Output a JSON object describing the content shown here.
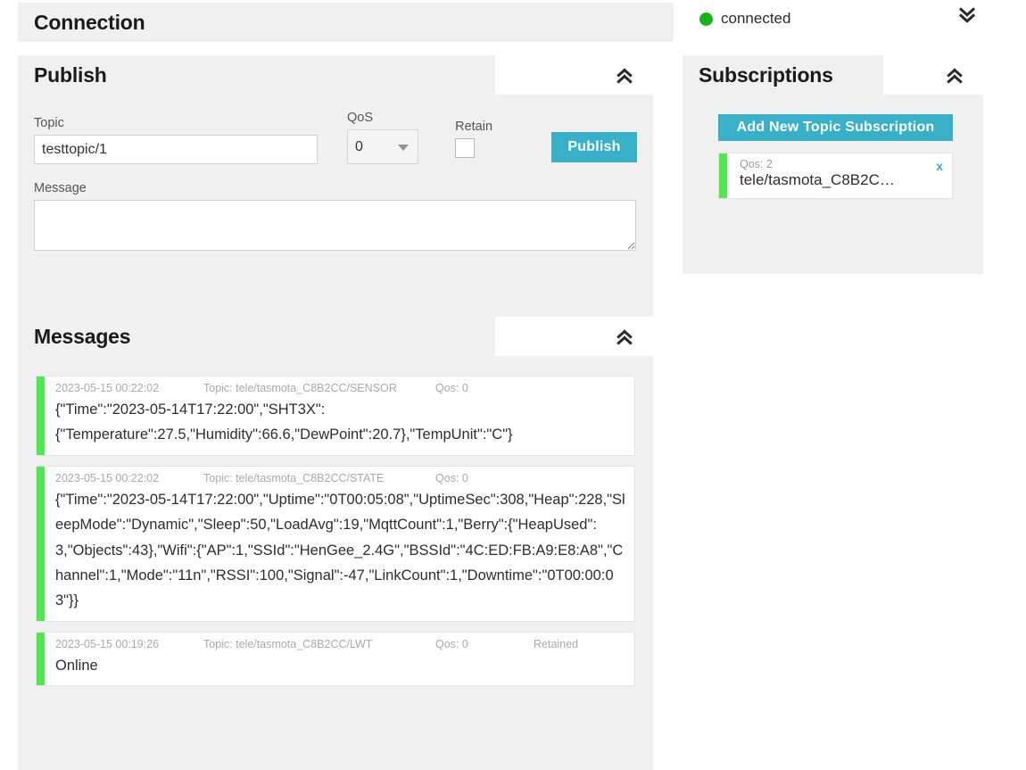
{
  "connection": {
    "title": "Connection",
    "status_text": "connected",
    "status_color": "#17b317",
    "toggle_icon": "chevron-double-down-icon"
  },
  "publish": {
    "title": "Publish",
    "toggle_icon": "chevron-double-up-icon",
    "topic_label": "Topic",
    "topic_value": "testtopic/1",
    "topic_placeholder": "",
    "qos_label": "QoS",
    "qos_value": "0",
    "qos_options": [
      "0",
      "1",
      "2"
    ],
    "retain_label": "Retain",
    "retain_checked": false,
    "publish_button": "Publish",
    "message_label": "Message",
    "message_value": "",
    "message_placeholder": "",
    "accent_color": "#38b0c8"
  },
  "subscriptions": {
    "title": "Subscriptions",
    "toggle_icon": "chevron-double-up-icon",
    "add_button": "Add New Topic Subscription",
    "accent_color": "#38b0c8",
    "items": [
      {
        "qos": "Qos: 2",
        "topic": "tele/tasmota_C8B2C…",
        "delete_label": "x",
        "bar_color": "#4cea4c"
      }
    ]
  },
  "messages": {
    "title": "Messages",
    "toggle_icon": "chevron-double-up-icon",
    "items": [
      {
        "time": "2023-05-15 00:22:02",
        "topic": "Topic: tele/tasmota_C8B2CC/SENSOR",
        "qos": "Qos: 0",
        "retained": "",
        "payload": "{\"Time\":\"2023-05-14T17:22:00\",\"SHT3X\":\n{\"Temperature\":27.5,\"Humidity\":66.6,\"DewPoint\":20.7},\"TempUnit\":\"C\"}",
        "bar_color": "#4cea4c"
      },
      {
        "time": "2023-05-15 00:22:02",
        "topic": "Topic: tele/tasmota_C8B2CC/STATE",
        "qos": "Qos: 0",
        "retained": "",
        "payload": "{\"Time\":\"2023-05-14T17:22:00\",\"Uptime\":\"0T00:05:08\",\"UptimeSec\":308,\"Heap\":228,\"SleepMode\":\"Dynamic\",\"Sleep\":50,\"LoadAvg\":19,\"MqttCount\":1,\"Berry\":{\"HeapUsed\":3,\"Objects\":43},\"Wifi\":{\"AP\":1,\"SSId\":\"HenGee_2.4G\",\"BSSId\":\"4C:ED:FB:A9:E8:A8\",\"Channel\":1,\"Mode\":\"11n\",\"RSSI\":100,\"Signal\":-47,\"LinkCount\":1,\"Downtime\":\"0T00:00:03\"}}",
        "bar_color": "#4cea4c"
      },
      {
        "time": "2023-05-15 00:19:26",
        "topic": "Topic: tele/tasmota_C8B2CC/LWT",
        "qos": "Qos: 0",
        "retained": "Retained",
        "payload": "Online",
        "bar_color": "#4cea4c"
      }
    ]
  }
}
